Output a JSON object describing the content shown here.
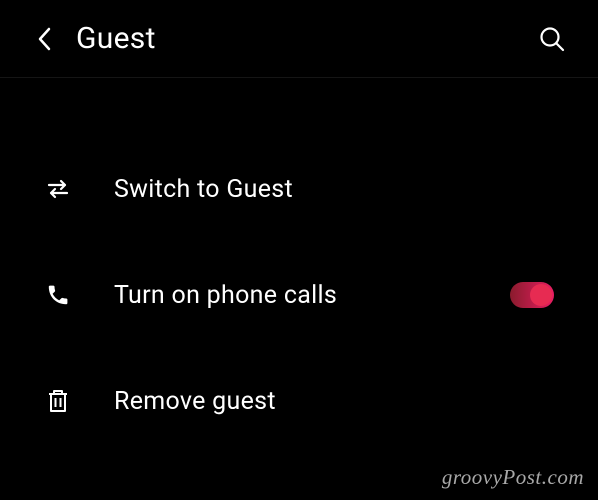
{
  "header": {
    "title": "Guest"
  },
  "list": {
    "switch": {
      "label": "Switch to Guest"
    },
    "phone": {
      "label": "Turn on phone calls",
      "enabled": true
    },
    "remove": {
      "label": "Remove guest"
    }
  },
  "watermark": "groovyPost.com",
  "colors": {
    "accent": "#e91e63"
  }
}
